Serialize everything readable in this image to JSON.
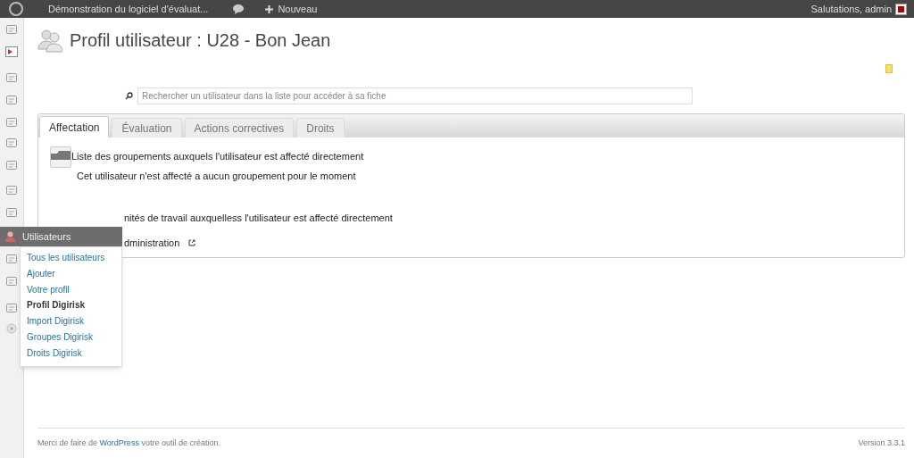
{
  "admin_bar": {
    "site_title": "Démonstration du logiciel d'évaluat...",
    "new_label": "Nouveau",
    "greeting": "Salutations, admin"
  },
  "page": {
    "title": "Profil utilisateur : U28 - Bon Jean"
  },
  "search": {
    "placeholder": "Rechercher un utilisateur dans la liste pour accéder à sa fiche"
  },
  "tabs": [
    {
      "label": "Affectation",
      "selected": true
    },
    {
      "label": "Évaluation",
      "selected": false
    },
    {
      "label": "Actions correctives",
      "selected": false
    },
    {
      "label": "Droits",
      "selected": false
    }
  ],
  "sections": [
    {
      "heading": "Liste des groupements auxquels l'utilisateur est affecté directement",
      "message": "Cet utilisateur n'est affecté a aucun groupement pour le moment"
    },
    {
      "heading": "nités de travail auxquelless l'utilisateur est affecté directement",
      "link": "dministration"
    }
  ],
  "flyout_menu": {
    "title": "Utilisateurs",
    "items": [
      {
        "label": "Tous les utilisateurs",
        "selected": false
      },
      {
        "label": "Ajouter",
        "selected": false
      },
      {
        "label": "Votre profil",
        "selected": false
      },
      {
        "label": "Profil Digirisk",
        "selected": true
      },
      {
        "label": "Import Digirisk",
        "selected": false
      },
      {
        "label": "Groupes Digirisk",
        "selected": false
      },
      {
        "label": "Droits Digirisk",
        "selected": false
      }
    ]
  },
  "footer": {
    "text_before": "Merci de faire de",
    "link": "WordPress",
    "text_after": "votre outil de création.",
    "version": "Version 3.3.1"
  }
}
